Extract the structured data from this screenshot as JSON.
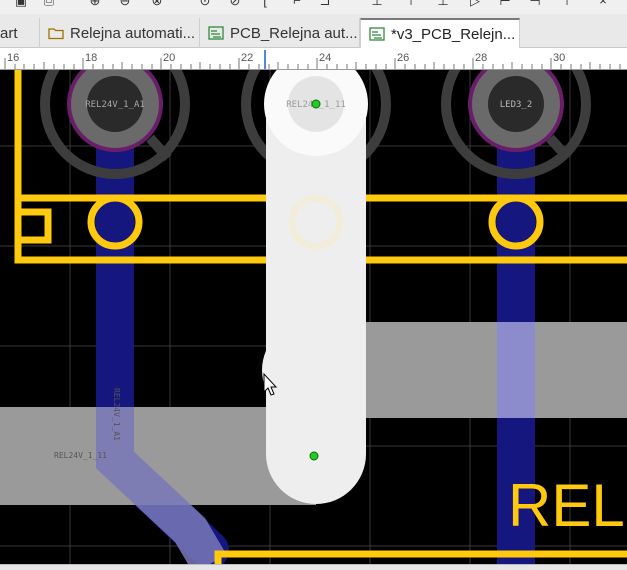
{
  "tabs": [
    {
      "label": "art",
      "type": "partial"
    },
    {
      "label": "Relejna automati...",
      "type": "folder"
    },
    {
      "label": "PCB_Relejna aut...",
      "type": "pcb"
    },
    {
      "label": "*v3_PCB_Relejn...",
      "type": "pcb",
      "active": true
    }
  ],
  "ruler": {
    "labels": [
      "16",
      "18",
      "20",
      "22",
      "24",
      "26",
      "28",
      "30"
    ]
  },
  "pcb": {
    "pads": [
      {
        "label": "REL24V_1_A1"
      },
      {
        "label": "REL24V_1_11"
      },
      {
        "label": "LED3_2"
      }
    ],
    "trace_labels": [
      "REL24V_1_A1",
      "REL24V_1_11"
    ],
    "silkscreen_text": "REL",
    "colors": {
      "background": "#000000",
      "silkscreen": "#ffc90e",
      "copper_bottom": "#1a1a8c",
      "highlight": "#e8e8e8",
      "courtyard": "#3c3c3c",
      "via_mark": "#22cc22"
    }
  }
}
